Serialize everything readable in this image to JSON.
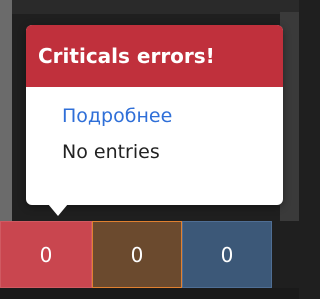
{
  "popover": {
    "title": "Criticals errors!",
    "details_link": "Подробнее",
    "empty_text": "No entries"
  },
  "counters": [
    {
      "value": "0",
      "color": "#c9464f"
    },
    {
      "value": "0",
      "color": "#6b4a2e"
    },
    {
      "value": "0",
      "color": "#3c5878"
    }
  ]
}
